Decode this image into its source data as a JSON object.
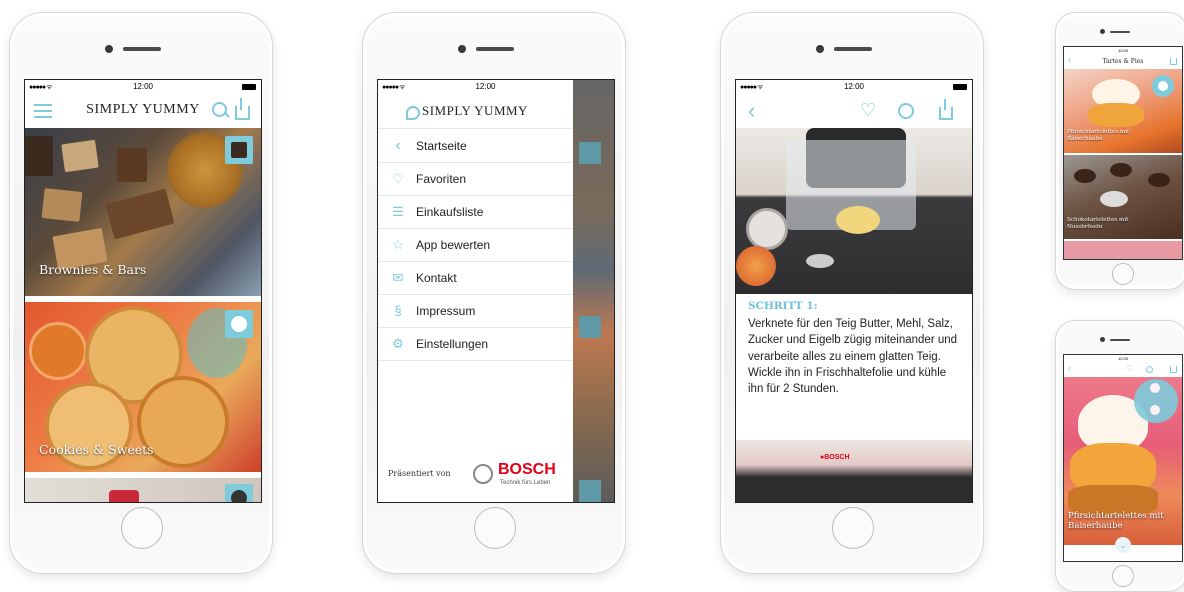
{
  "status": {
    "time": "12:00",
    "signal": "●●●●● ᯤ"
  },
  "screen1": {
    "app_title": "SIMPLY YUMMY",
    "tiles": [
      {
        "label": "Brownies & Bars"
      },
      {
        "label": "Cookies & Sweets"
      }
    ]
  },
  "screen2": {
    "app_title": "SIMPLY YUMMY",
    "menu": [
      {
        "label": "Startseite",
        "icon": "chevron-left-icon"
      },
      {
        "label": "Favoriten",
        "icon": "heart-icon"
      },
      {
        "label": "Einkaufsliste",
        "icon": "list-icon"
      },
      {
        "label": "App bewerten",
        "icon": "star-icon"
      },
      {
        "label": "Kontakt",
        "icon": "mail-icon"
      },
      {
        "label": "Impressum",
        "icon": "paragraph-icon"
      },
      {
        "label": "Einstellungen",
        "icon": "gear-icon"
      }
    ],
    "footer": {
      "presented_by": "Präsentiert von",
      "brand": "BOSCH",
      "tagline": "Technik fürs Leben"
    }
  },
  "screen3": {
    "step_title": "SCHRITT 1:",
    "step_text": "Verknete für den Teig Butter, Mehl, Salz, Zucker und Eigelb zügig miteinander und verarbeite alles zu einem glatten Teig. Wickle ihn in Frischhaltefolie und kühle ihn für 2 Stunden."
  },
  "screen4": {
    "nav_title": "Tartes & Pies",
    "items": [
      {
        "label": "Pfirsichtartelettes mit Baiserhaube"
      },
      {
        "label": "Schokotartelettes mit Nussbröseln"
      }
    ]
  },
  "screen5": {
    "detail_title": "Pfirsichtartelettes mit Baiserhaube"
  },
  "colors": {
    "accent": "#6cc3d8",
    "bosch_red": "#e20015"
  }
}
